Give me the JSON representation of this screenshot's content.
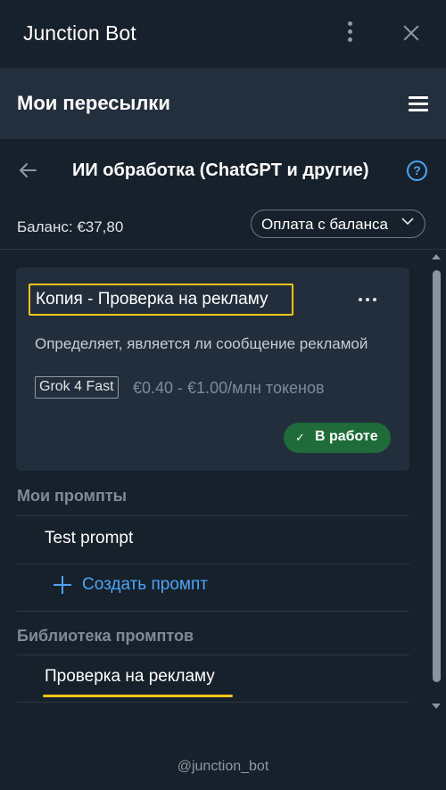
{
  "app": {
    "title": "Junction Bot"
  },
  "header": {
    "title": "Мои пересылки"
  },
  "section": {
    "title": "ИИ обработка (ChatGPT и другие)",
    "help": "?"
  },
  "balance": {
    "label": "Баланс: €37,80",
    "payment_mode": "Оплата с баланса"
  },
  "card": {
    "title": "Копия - Проверка на рекламу",
    "description": "Определяет, является ли сообщение рекламой",
    "model": "Grok 4 Fast",
    "price": "€0.40 - €1.00/млн токенов",
    "status": "В работе",
    "status_check": "✓"
  },
  "my_prompts": {
    "heading": "Мои промпты",
    "items": [
      "Test prompt"
    ],
    "create_label": "Создать промпт"
  },
  "library": {
    "heading": "Библиотека промптов",
    "items": [
      "Проверка на рекламу"
    ]
  },
  "footer": {
    "handle": "@junction_bot"
  },
  "colors": {
    "background": "#17212b",
    "header_bg": "#242f3d",
    "card_bg": "#232e3c",
    "accent_blue": "#4ea4f6",
    "highlight_yellow": "#f5c518",
    "status_green": "#1f6b3a"
  },
  "icons": {
    "titlebar": [
      "more-vertical-icon",
      "close-icon"
    ],
    "header": [
      "hamburger-menu-icon"
    ],
    "section": [
      "back-arrow-icon",
      "help-icon"
    ],
    "select": [
      "chevron-down-icon"
    ],
    "card": [
      "more-horizontal-icon",
      "check-icon"
    ],
    "prompts": [
      "plus-icon"
    ]
  }
}
